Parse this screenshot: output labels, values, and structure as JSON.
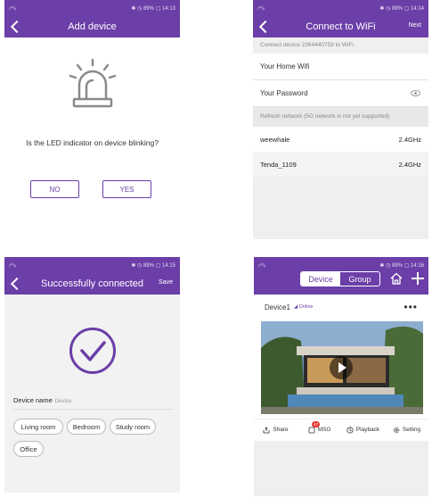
{
  "colors": {
    "brand": "#6b3ea8",
    "badge": "#e53935"
  },
  "screens": {
    "add_device": {
      "status": {
        "left": "ᵢ⁴⁶ᵢₗ",
        "right": "✱ ◷ 89% ▢ 14:13"
      },
      "title": "Add device",
      "question": "Is the LED indicator on device blinking?",
      "no_label": "NO",
      "yes_label": "YES",
      "icons": {
        "back": "back-icon",
        "illustration": "beacon-light-icon"
      }
    },
    "connect_wifi": {
      "status": {
        "left": "ᵢ⁴⁶ᵢₗ",
        "right": "✱ ◷ 89% ▢ 14:14"
      },
      "title": "Connect to WiFi",
      "next_label": "Next",
      "info": "Connect device 2364440759 to WiFi",
      "ssid_value": "Your Home Wifi",
      "password_value": "Your Password",
      "refresh_text": "Refresh network (5G network is not yet supported)",
      "networks": [
        {
          "name": "weewhale",
          "band": "2.4GHz"
        },
        {
          "name": "Tenda_1109",
          "band": "2.4GHz"
        }
      ]
    },
    "success": {
      "status": {
        "left": "ᵢ⁴⁶ᵢₗ",
        "right": "✱ ◷ 89% ▢ 14:15"
      },
      "title": "Successfully connected",
      "save_label": "Save",
      "device_name_label": "Device name",
      "device_name_hint": "Device",
      "rooms": [
        "Living room",
        "Bedroom",
        "Study room",
        "Office"
      ]
    },
    "device_list": {
      "status": {
        "left": "ᵢ⁴⁶ᵢₗ",
        "right": "✱ ◷ 89% ▢ 14:16"
      },
      "tabs": [
        "Device",
        "Group"
      ],
      "device_name": "Device1",
      "device_status": "Online",
      "more": "•••",
      "msg_badge": "47",
      "actions": [
        "Share",
        "MSG",
        "Playback",
        "Setting"
      ]
    }
  }
}
